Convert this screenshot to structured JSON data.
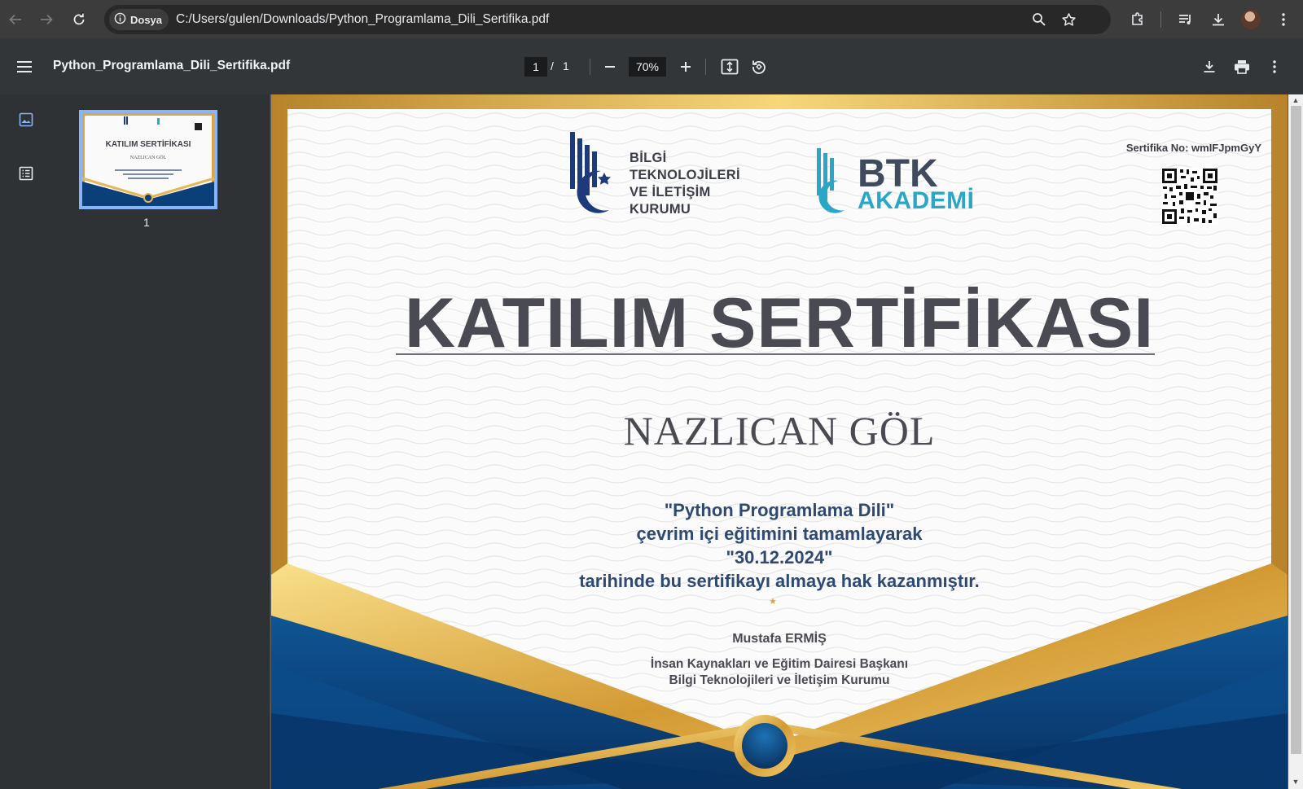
{
  "browser": {
    "site_chip_label": "Dosya",
    "url": "C:/Users/gulen/Downloads/Python_Programlama_Dili_Sertifika.pdf"
  },
  "pdf_toolbar": {
    "file_name": "Python_Programlama_Dili_Sertifika.pdf",
    "current_page": "1",
    "page_separator": "/",
    "total_pages": "1",
    "zoom": "70%"
  },
  "sidebar": {
    "thumbnail_page_number": "1"
  },
  "certificate": {
    "certificate_no": "Sertifika No: wmIFJpmGyY",
    "org_name_lines": [
      "BİLGİ",
      "TEKNOLOJİLERİ",
      "VE İLETİŞİM",
      "KURUMU"
    ],
    "academy_top": "BTK",
    "academy_bottom": "AKADEMİ",
    "title": "KATILIM SERTİFİKASI",
    "recipient": "NAZLICAN GÖL",
    "body_lines": [
      "\"Python Programlama Dili\"",
      "çevrim içi eğitimini tamamlayarak",
      "\"30.12.2024\"",
      "tarihinde bu sertifikayı almaya hak kazanmıştır."
    ],
    "signer_name": "Mustafa ERMİŞ",
    "signer_title_lines": [
      "İnsan Kaynakları ve Eğitim Dairesi Başkanı",
      "Bilgi Teknolojileri ve İletişim Kurumu"
    ],
    "thumbnail_title": "KATILIM SERTİFİKASI",
    "thumbnail_name": "NAZLICAN GÖL"
  },
  "colors": {
    "accent_blue": "#8ab4f8",
    "gold": "#e7b755",
    "navy": "#0b3f7a",
    "text_blue": "#2f4a72"
  },
  "icons": [
    "back-icon",
    "forward-icon",
    "reload-icon",
    "info-icon",
    "zoom-icon",
    "star-icon",
    "extensions-icon",
    "media-icon",
    "download-icon",
    "more-icon",
    "menu-icon",
    "minus-icon",
    "plus-icon",
    "fit-page-icon",
    "rotate-icon",
    "print-icon",
    "thumbnail-icon",
    "outline-icon"
  ]
}
